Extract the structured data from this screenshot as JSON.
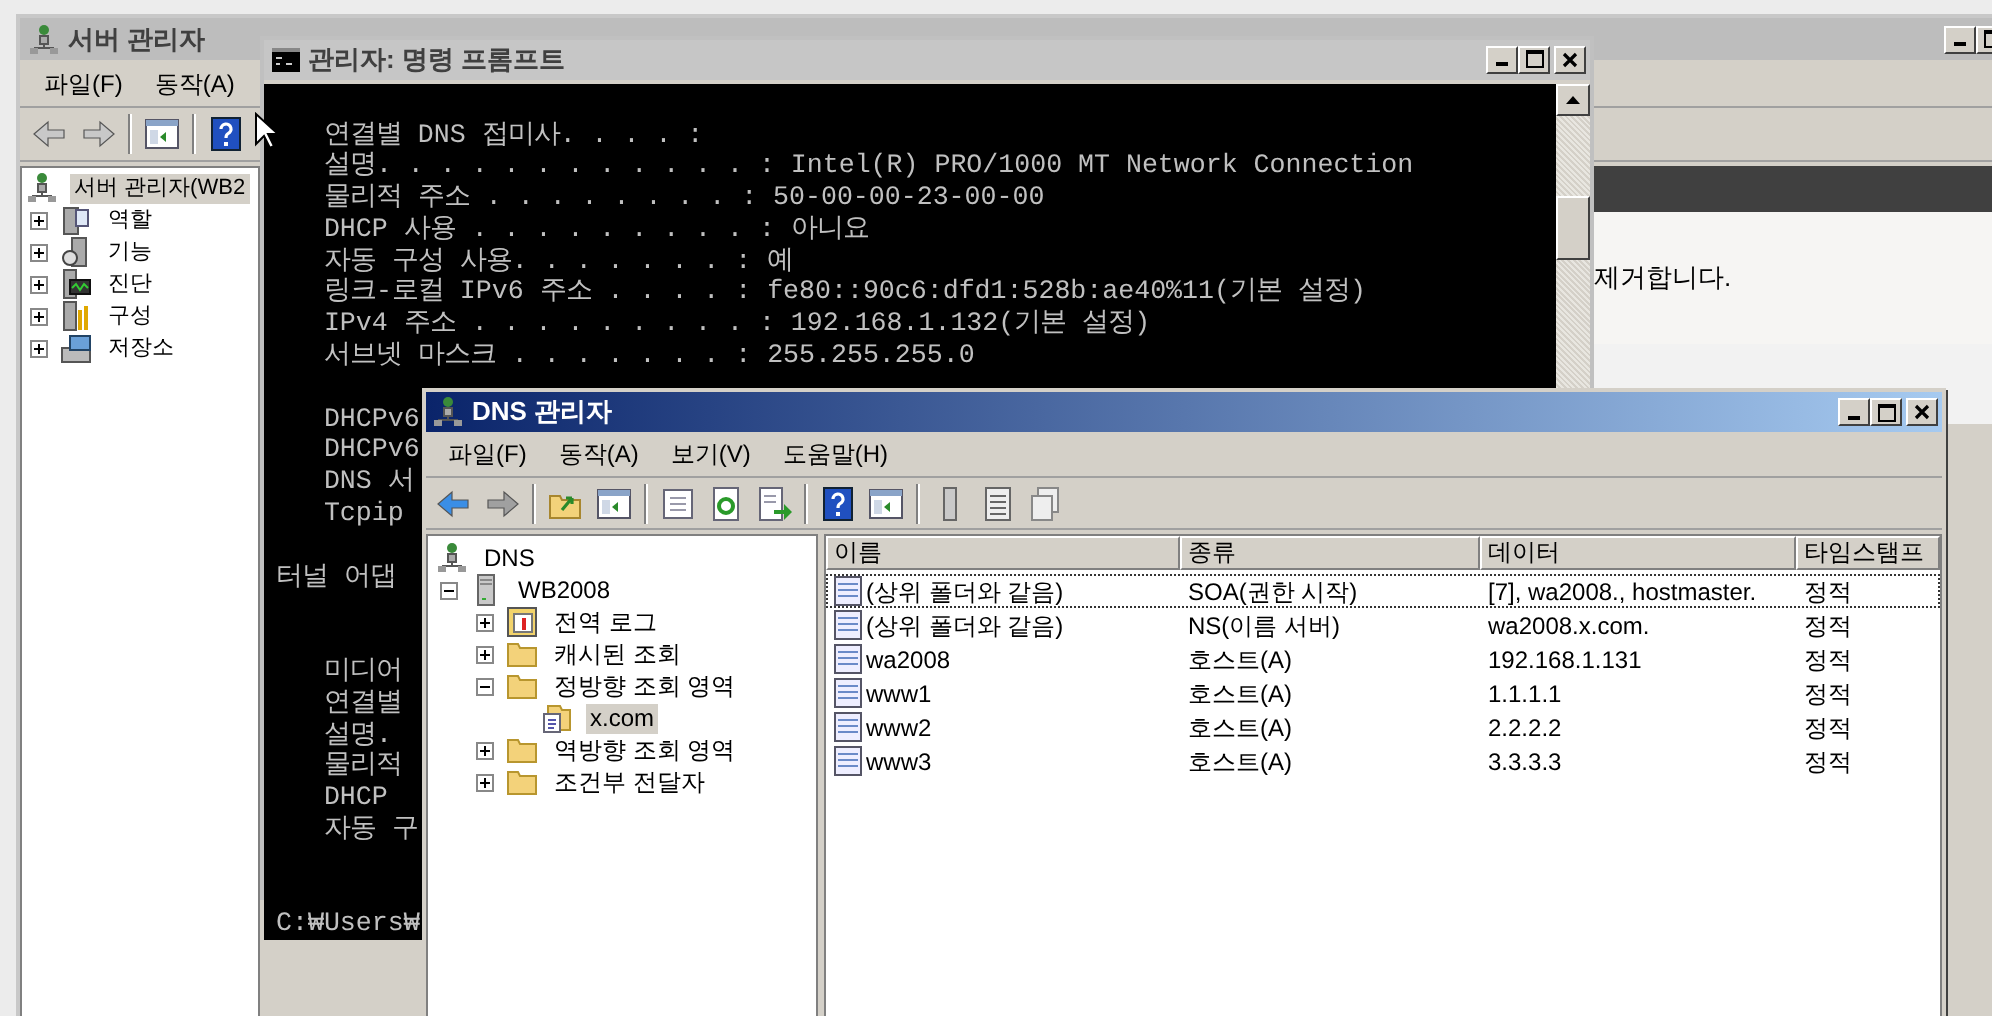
{
  "server_manager": {
    "title": "서버 관리자",
    "menu": [
      "파일(F)",
      "동작(A)"
    ],
    "tree": {
      "label": "서버 관리자(WB2",
      "kind": "manager",
      "selected": true,
      "children": [
        {
          "label": "역할",
          "kind": "roles",
          "expanded": false,
          "selected": false
        },
        {
          "label": "기능",
          "kind": "features",
          "expanded": false,
          "selected": false
        },
        {
          "label": "진단",
          "kind": "diagnostics",
          "expanded": false,
          "selected": false
        },
        {
          "label": "구성",
          "kind": "configuration",
          "expanded": false,
          "selected": false
        },
        {
          "label": "저장소",
          "kind": "storage",
          "expanded": false,
          "selected": false
        }
      ]
    },
    "description": "제거합니다."
  },
  "command_prompt": {
    "title": "관리자: 명령 프롬프트",
    "blocks": [
      [
        "   연결별 DNS 접미사. . . . :",
        "   설명. . . . . . . . . . . . : Intel(R) PRO/1000 MT Network Connection",
        "   물리적 주소 . . . . . . . . : 50-00-00-23-00-00",
        "   DHCP 사용 . . . . . . . . . : 아니요",
        "   자동 구성 사용. . . . . . . : 예",
        "   링크-로컬 IPv6 주소 . . . . : fe80::90c6:dfd1:528b:ae40%11(기본 설정)",
        "   IPv4 주소 . . . . . . . . . : 192.168.1.132(기본 설정)",
        "   서브넷 마스크 . . . . . . . : 255.255.255.0",
        "   DHCPv6",
        "   DHCPv6",
        "   DNS 서",
        "   Tcpip"
      ],
      [
        "터널 어댑"
      ],
      [
        "   미디어",
        "   연결별",
        "   설명.",
        "   물리적",
        "   DHCP",
        "   자동 구"
      ],
      [
        "C:₩Users₩"
      ]
    ]
  },
  "dns_manager": {
    "title": "DNS 관리자",
    "menu": [
      "파일(F)",
      "동작(A)",
      "보기(V)",
      "도움말(H)"
    ],
    "tree": {
      "label": "DNS",
      "kind": "dns",
      "selected": false,
      "children": [
        {
          "label": "WB2008",
          "kind": "server",
          "expanded": true,
          "selected": false,
          "children": [
            {
              "label": "전역 로그",
              "kind": "log",
              "expanded": false,
              "selected": false
            },
            {
              "label": "캐시된 조회",
              "kind": "folder",
              "expanded": false,
              "selected": false
            },
            {
              "label": "정방향 조회 영역",
              "kind": "folder",
              "expanded": true,
              "selected": false,
              "children": [
                {
                  "label": "x.com",
                  "kind": "zone",
                  "selected": true
                }
              ]
            },
            {
              "label": "역방향 조회 영역",
              "kind": "folder",
              "expanded": false,
              "selected": false
            },
            {
              "label": "조건부 전달자",
              "kind": "folder",
              "expanded": false,
              "selected": false
            }
          ]
        }
      ]
    },
    "columns": [
      "이름",
      "종류",
      "데이터",
      "타임스탬프"
    ],
    "rows": [
      {
        "cells": [
          "(상위 폴더와 같음)",
          "SOA(권한 시작)",
          "[7], wa2008., hostmaster.",
          "정적"
        ],
        "focused": true,
        "selected": false
      },
      {
        "cells": [
          "(상위 폴더와 같음)",
          "NS(이름 서버)",
          "wa2008.x.com.",
          "정적"
        ],
        "focused": false,
        "selected": false
      },
      {
        "cells": [
          "wa2008",
          "호스트(A)",
          "192.168.1.131",
          "정적"
        ],
        "focused": false,
        "selected": false
      },
      {
        "cells": [
          "www1",
          "호스트(A)",
          "1.1.1.1",
          "정적"
        ],
        "focused": false,
        "selected": false
      },
      {
        "cells": [
          "www2",
          "호스트(A)",
          "2.2.2.2",
          "정적"
        ],
        "focused": false,
        "selected": false
      },
      {
        "cells": [
          "www3",
          "호스트(A)",
          "3.3.3.3",
          "정적"
        ],
        "focused": false,
        "selected": false
      }
    ]
  }
}
